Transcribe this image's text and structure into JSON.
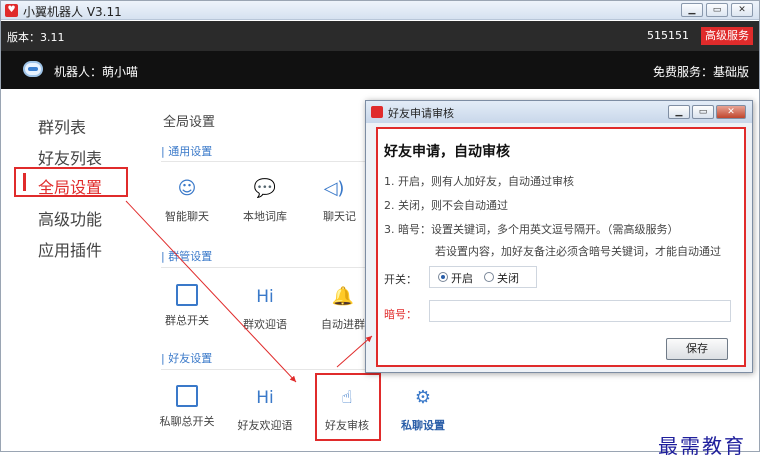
{
  "window": {
    "title": "小翼机器人 V3.11",
    "controls": [
      "minimize",
      "maximize",
      "close"
    ]
  },
  "version_bar": {
    "version": "版本：3.11",
    "user_id": "515151",
    "premium": "高级服务"
  },
  "robot_bar": {
    "name": "机器人：萌小喵",
    "service": "免费服务：基础版"
  },
  "sidebar": {
    "items": [
      {
        "label": "群列表",
        "active": false
      },
      {
        "label": "好友列表",
        "active": false
      },
      {
        "label": "全局设置",
        "active": true
      },
      {
        "label": "高级功能",
        "active": false
      },
      {
        "label": "应用插件",
        "active": false
      }
    ]
  },
  "content": {
    "title": "全局设置",
    "sections": [
      {
        "label": "| 通用设置",
        "tiles": [
          {
            "label": "智能聊天",
            "icon": "brain-icon"
          },
          {
            "label": "本地词库",
            "icon": "chat-bubble-icon"
          },
          {
            "label": "聊天记",
            "icon": "speaker-icon"
          }
        ]
      },
      {
        "label": "| 群管设置",
        "tiles": [
          {
            "label": "群总开关",
            "icon": "phone-icon"
          },
          {
            "label": "群欢迎语",
            "icon": "hi-icon",
            "glyph": "Hi"
          },
          {
            "label": "自动进群",
            "icon": "bell-icon"
          }
        ]
      },
      {
        "label": "| 好友设置",
        "tiles": [
          {
            "label": "私聊总开关",
            "icon": "phone-icon"
          },
          {
            "label": "好友欢迎语",
            "icon": "hi-icon",
            "glyph": "Hi"
          },
          {
            "label": "好友审核",
            "icon": "document-hand-icon",
            "highlighted": true
          },
          {
            "label": "私聊设置",
            "icon": "gear-icon"
          }
        ]
      }
    ]
  },
  "dialog": {
    "title": "好友申请审核",
    "heading": "好友申请，自动审核",
    "lines": [
      "1.  开启，则有人加好友，自动通过审核",
      "2.  关闭，则不会自动通过",
      "3.  暗号：设置关键词，多个用英文逗号隔开。（需高级服务）",
      "若设置内容，加好友备注必须含暗号关键词，才能自动通过"
    ],
    "switch_label": "开关：",
    "options": [
      "开启",
      "关闭"
    ],
    "selected": "开启",
    "password_label": "暗号：",
    "password_value": "",
    "save": "保存"
  },
  "watermark": "最需教育",
  "colors": {
    "accent": "#e02b2b",
    "link_blue": "#3a79c9",
    "dark_bar": "#111111"
  }
}
